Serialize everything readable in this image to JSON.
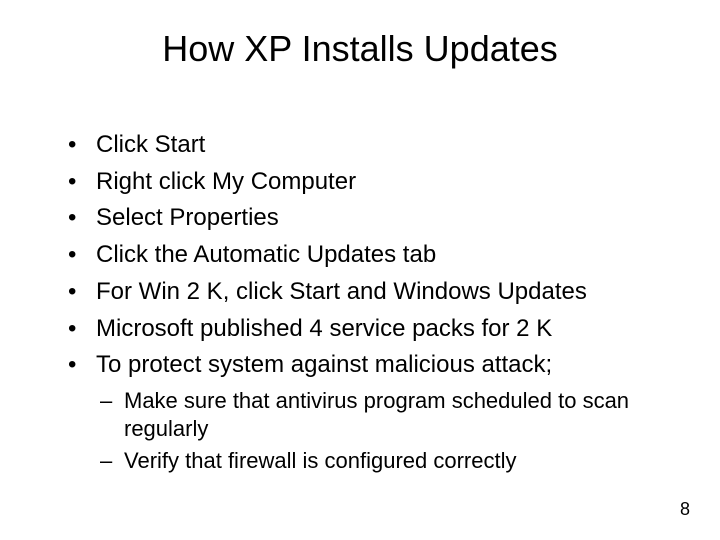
{
  "slide": {
    "title": "How XP Installs Updates",
    "bullets": [
      "Click Start",
      "Right click My Computer",
      "Select Properties",
      "Click the Automatic Updates tab",
      "For Win 2 K, click Start and Windows Updates",
      "Microsoft published 4 service packs for 2 K",
      "To protect system against malicious attack;"
    ],
    "sub_bullets": [
      "Make sure that antivirus program scheduled to scan regularly",
      "Verify that firewall is configured correctly"
    ],
    "page_number": "8"
  }
}
